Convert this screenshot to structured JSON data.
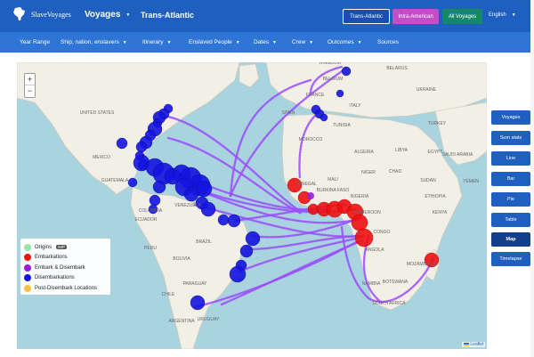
{
  "header": {
    "logo_text": "SlaveVoyages",
    "voyages_label": "Voyages",
    "subtitle": "Trans-Atlantic",
    "buttons": [
      {
        "label": "Trans-Atlantic",
        "color": "#1a4fb0",
        "border": "#ffffff"
      },
      {
        "label": "Intra-American",
        "color": "#c24fc7",
        "border": "#c24fc7"
      },
      {
        "label": "All Voyages",
        "color": "#16886a",
        "border": "#16886a"
      }
    ],
    "language": "English"
  },
  "filters": [
    {
      "label": "Year Range",
      "has_caret": false
    },
    {
      "label": "Ship, nation, enslavers",
      "has_caret": true
    },
    {
      "label": "Itinerary",
      "has_caret": true
    },
    {
      "label": "Enslaved People",
      "has_caret": true
    },
    {
      "label": "Dates",
      "has_caret": true
    },
    {
      "label": "Crew",
      "has_caret": true
    },
    {
      "label": "Outcomes",
      "has_caret": true
    },
    {
      "label": "Sources",
      "has_caret": false
    }
  ],
  "map": {
    "zoom_in": "+",
    "zoom_out": "−",
    "attribution": "Leaflet",
    "colors": {
      "ocean": "#a9d3df",
      "land": "#f2efe6",
      "route": "#9a4bff",
      "disembark": "#1414e0",
      "embark": "#ee1111"
    },
    "labels": [
      {
        "text": "UNITED STATES"
      },
      {
        "text": "MEXICO"
      },
      {
        "text": "GUATEMALA"
      },
      {
        "text": "COLOMBIA"
      },
      {
        "text": "VENEZUELA"
      },
      {
        "text": "ECUADOR"
      },
      {
        "text": "PERU"
      },
      {
        "text": "BRAZIL"
      },
      {
        "text": "BOLIVIA"
      },
      {
        "text": "PARAGUAY"
      },
      {
        "text": "CHILE"
      },
      {
        "text": "ARGENTINA"
      },
      {
        "text": "URUGUAY"
      },
      {
        "text": "KINGDOM"
      },
      {
        "text": "BELARUS"
      },
      {
        "text": "BELGIUM"
      },
      {
        "text": "UKRAINE"
      },
      {
        "text": "FRANCE"
      },
      {
        "text": "SPAIN"
      },
      {
        "text": "ITALY"
      },
      {
        "text": "TURKEY"
      },
      {
        "text": "TUNISIA"
      },
      {
        "text": "MOROCCO"
      },
      {
        "text": "ALGERIA"
      },
      {
        "text": "LIBYA"
      },
      {
        "text": "EGYPT"
      },
      {
        "text": "SAUDI ARABIA"
      },
      {
        "text": "MALI"
      },
      {
        "text": "NIGER"
      },
      {
        "text": "CHAD"
      },
      {
        "text": "SUDAN"
      },
      {
        "text": "BURKINA FASO"
      },
      {
        "text": "NIGERIA"
      },
      {
        "text": "ETHIOPIA"
      },
      {
        "text": "SENEGAL"
      },
      {
        "text": "CAMEROON"
      },
      {
        "text": "CONGO"
      },
      {
        "text": "KENYA"
      },
      {
        "text": "ANGOLA"
      },
      {
        "text": "NAMIBIA"
      },
      {
        "text": "MOZAMBIQUE"
      },
      {
        "text": "SOUTH AFRICA"
      },
      {
        "text": "BOTSWANA"
      },
      {
        "text": "YEMEN"
      }
    ]
  },
  "legend": {
    "items": [
      {
        "label": "Origins",
        "badge": "IMP",
        "color": "#9be3a8"
      },
      {
        "label": "Embarkations",
        "badge": "",
        "color": "#ee1111"
      },
      {
        "label": "Embark & Disembark",
        "badge": "",
        "color": "#9a1ee0"
      },
      {
        "label": "Disembarkations",
        "badge": "",
        "color": "#1414e0"
      },
      {
        "label": "Post-Disembark Locations",
        "badge": "",
        "color": "#f5c242"
      }
    ]
  },
  "views": [
    {
      "label": "Voyages",
      "active": false
    },
    {
      "label": "Sum stats",
      "active": false
    },
    {
      "label": "Line",
      "active": false
    },
    {
      "label": "Bar",
      "active": false
    },
    {
      "label": "Pie",
      "active": false
    },
    {
      "label": "Table",
      "active": false
    },
    {
      "label": "Map",
      "active": true
    },
    {
      "label": "Timelapse",
      "active": false
    }
  ]
}
